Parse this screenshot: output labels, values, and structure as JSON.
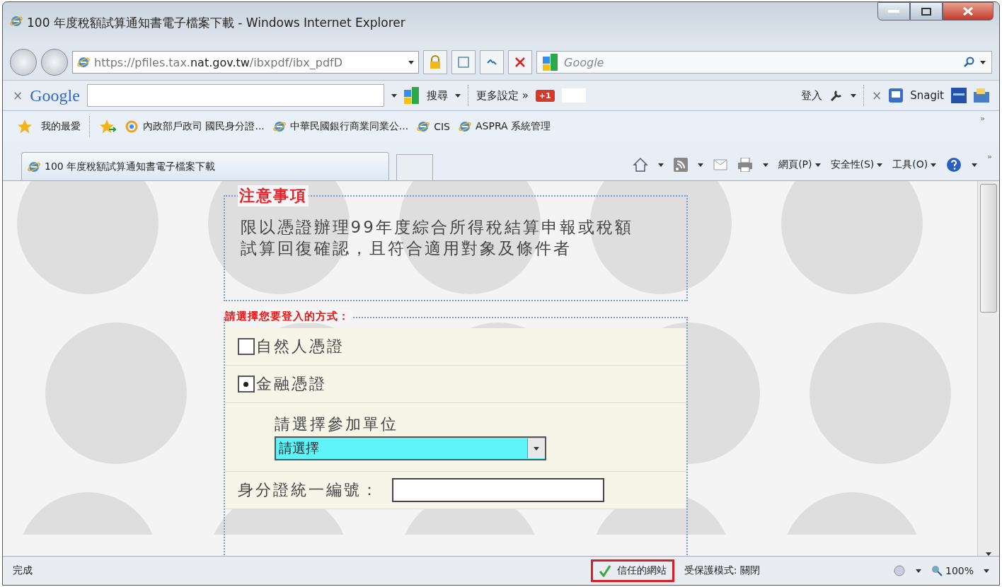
{
  "window": {
    "title": "100 年度稅額試算通知書電子檔案下載 - Windows Internet Explorer"
  },
  "address_bar": {
    "url_host_prefix": "https://pfiles.tax.",
    "url_host_main": "nat.gov.tw",
    "url_path": "/ibxpdf/ibx_pdfD",
    "search_placeholder": "Google"
  },
  "google_toolbar": {
    "close": "×",
    "logo": "Google",
    "search_label": "搜尋",
    "more_settings": "更多設定 »",
    "plus_one": "+1",
    "sign_in": "登入",
    "snagit_close": "×",
    "snagit": "Snagit"
  },
  "favorites": {
    "label": "我的最愛",
    "links": [
      {
        "kind": "sync",
        "label": "內政部戶政司 國民身分證..."
      },
      {
        "kind": "ie",
        "label": "中華民國銀行商業同業公..."
      },
      {
        "kind": "ie",
        "label": "CIS"
      },
      {
        "kind": "ie",
        "label": "ASPRA 系統管理"
      }
    ],
    "overflow": "»"
  },
  "tabs": [
    {
      "label": "100 年度稅額試算通知書電子檔案下載",
      "selected": true
    }
  ],
  "command_bar": {
    "menus": [
      "網頁(P)",
      "安全性(S)",
      "工具(O)"
    ],
    "overflow": "»"
  },
  "notice": {
    "title": "注意事項",
    "body": "限以憑證辦理99年度綜合所得稅結算申報或稅額試算回復確認，且符合適用對象及條件者"
  },
  "login": {
    "title": "請選擇您要登入的方式：",
    "options": [
      {
        "label": "自然人憑證",
        "selected": false
      },
      {
        "label": "金融憑證",
        "selected": true
      }
    ],
    "unit_label": "請選擇參加單位",
    "unit_select": "請選擇",
    "id_label": "身分證統一編號："
  },
  "status_bar": {
    "status": "完成",
    "zone": "信任的網站",
    "zone_highlighted": true,
    "protected_mode": "受保護模式: 關閉",
    "zoom": "100%"
  }
}
